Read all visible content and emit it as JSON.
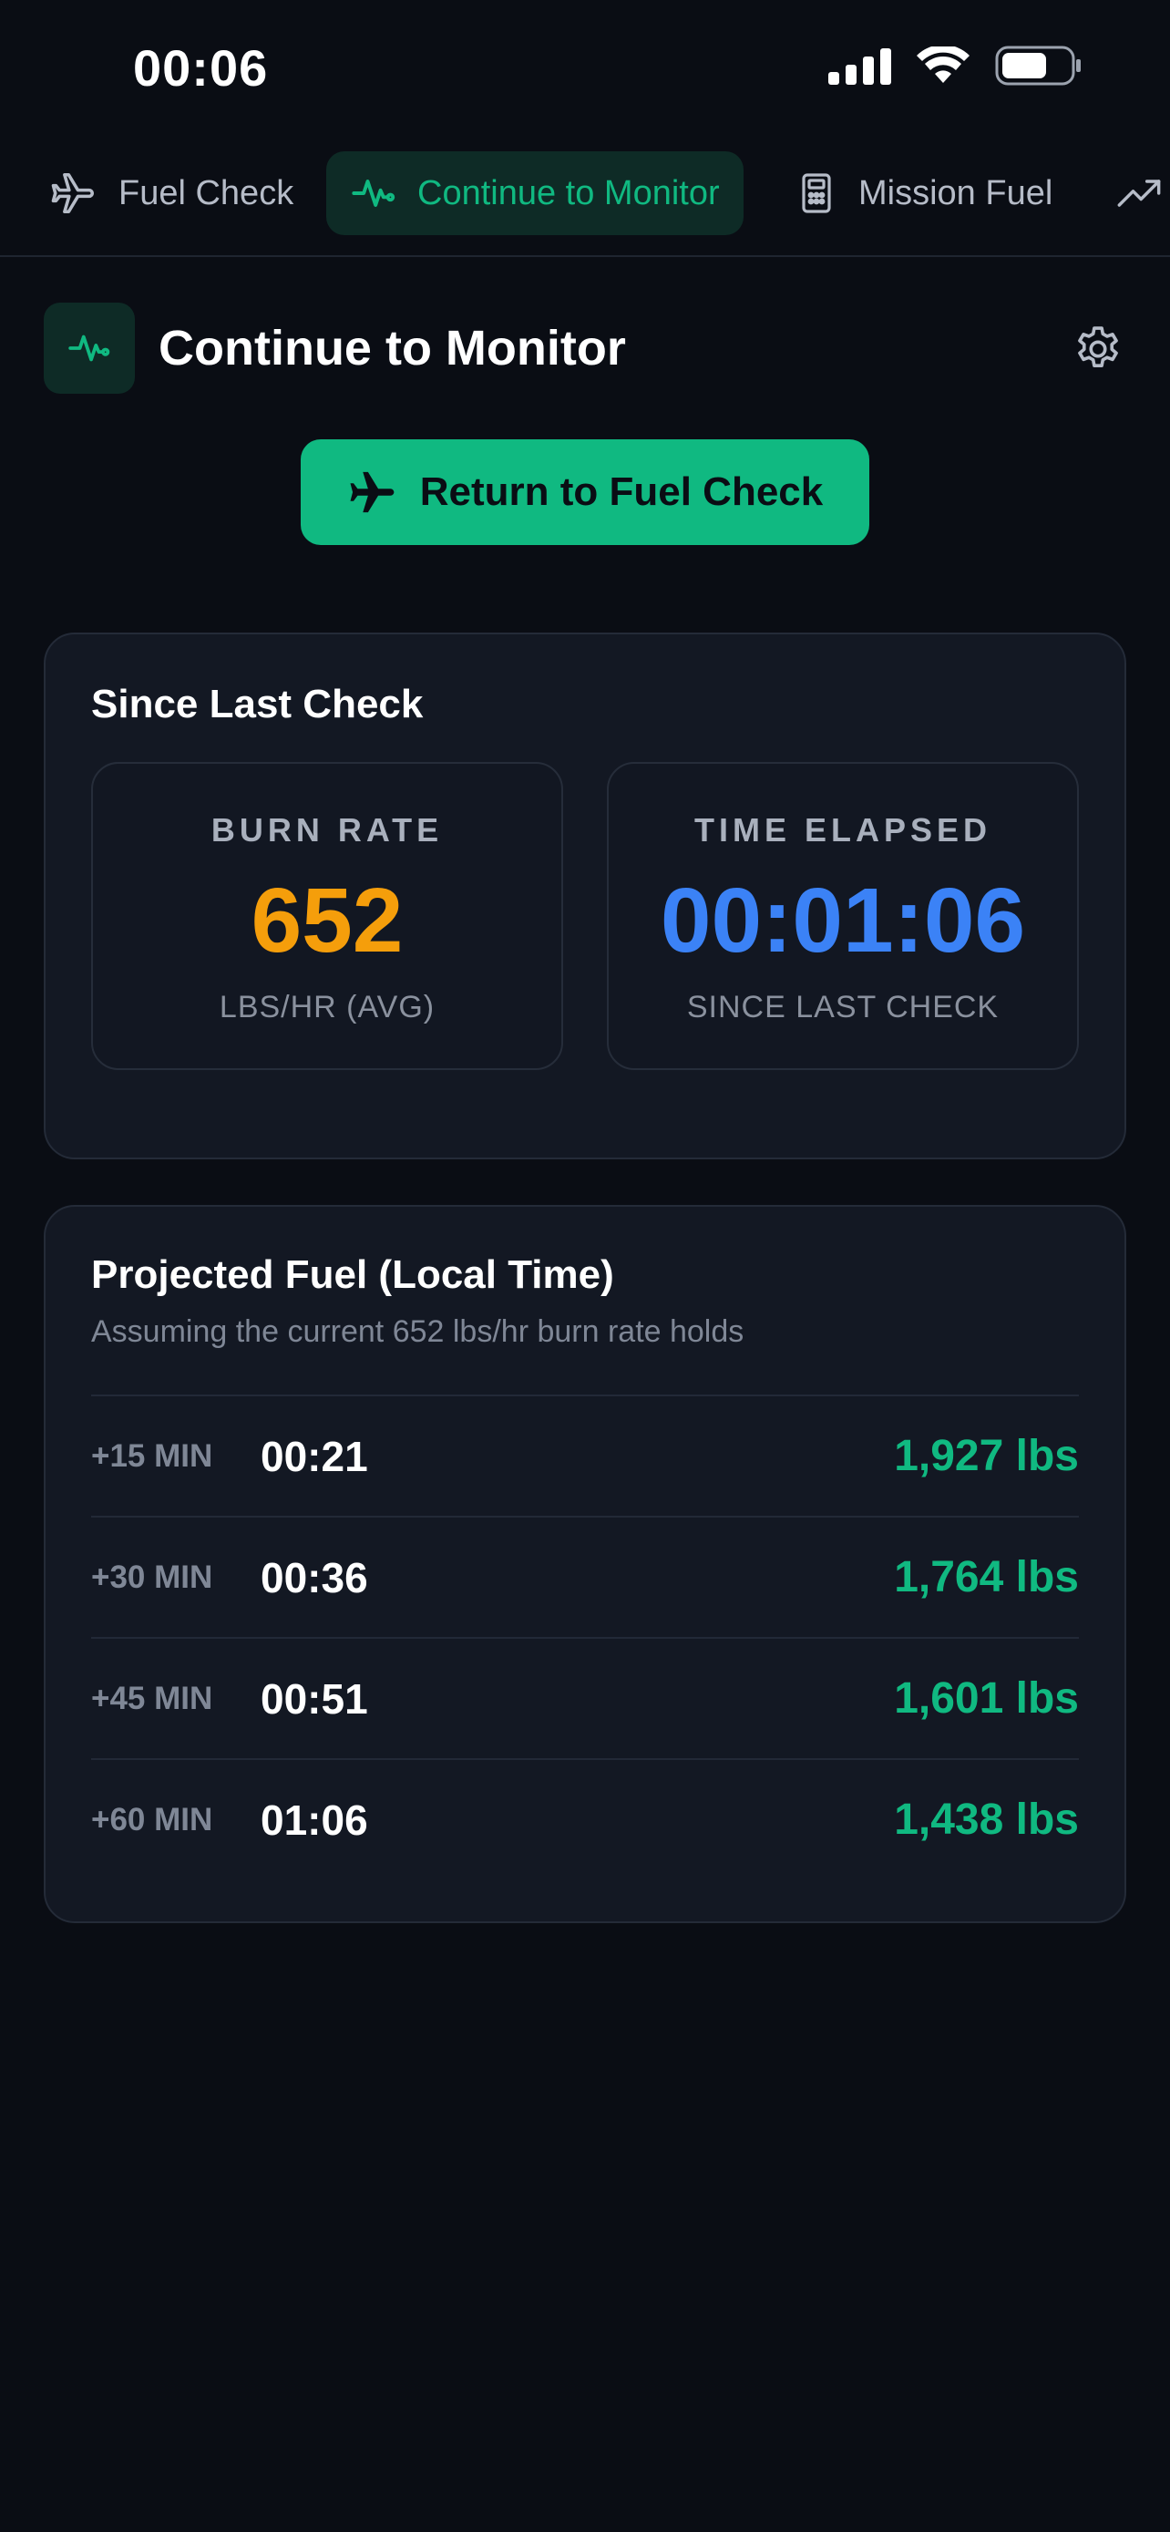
{
  "status_bar": {
    "time": "00:06"
  },
  "tabs": [
    {
      "label": "Fuel Check",
      "icon": "plane-icon",
      "active": false
    },
    {
      "label": "Continue to Monitor",
      "icon": "activity-icon",
      "active": true
    },
    {
      "label": "Mission Fuel",
      "icon": "calculator-icon",
      "active": false
    },
    {
      "label": "",
      "icon": "trending-up-icon",
      "active": false
    }
  ],
  "header": {
    "title": "Continue to Monitor",
    "icon": "activity-icon",
    "settings_icon": "gear-icon"
  },
  "return_button": {
    "label": "Return to Fuel Check",
    "icon": "plane-icon"
  },
  "since_last_check": {
    "title": "Since Last Check",
    "burn_rate": {
      "label": "BURN RATE",
      "value": "652",
      "unit": "LBS/HR (AVG)",
      "color": "#f59e0b"
    },
    "time_elapsed": {
      "label": "TIME ELAPSED",
      "value": "00:01:06",
      "unit": "SINCE LAST CHECK",
      "color": "#3b82f6"
    }
  },
  "projected": {
    "title": "Projected Fuel (Local Time)",
    "subtitle": "Assuming the current 652 lbs/hr burn rate holds",
    "rows": [
      {
        "offset": "+15 MIN",
        "time": "00:21",
        "fuel": "1,927 lbs"
      },
      {
        "offset": "+30 MIN",
        "time": "00:36",
        "fuel": "1,764 lbs"
      },
      {
        "offset": "+45 MIN",
        "time": "00:51",
        "fuel": "1,601 lbs"
      },
      {
        "offset": "+60 MIN",
        "time": "01:06",
        "fuel": "1,438 lbs"
      }
    ]
  },
  "colors": {
    "accent": "#10b981",
    "background": "#0a0d14",
    "card": "#131823"
  }
}
